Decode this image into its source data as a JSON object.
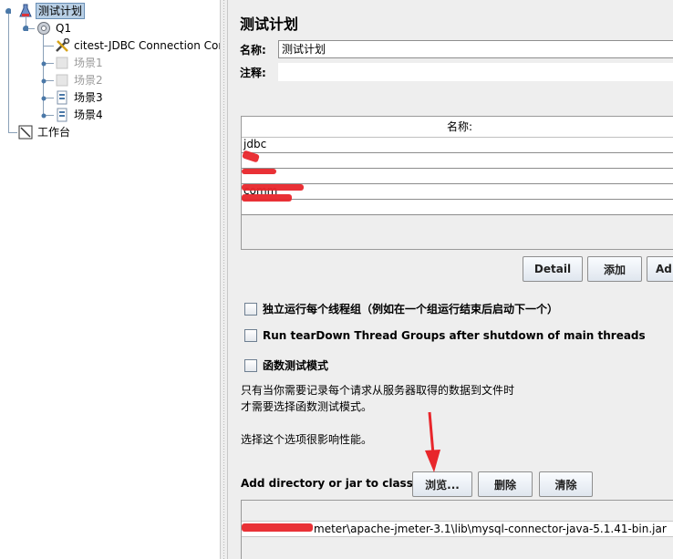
{
  "tree": {
    "root_label": "测试计划",
    "thread_group_label": "Q1",
    "jdbc_config_label": "citest-JDBC Connection Con",
    "scenes": [
      {
        "label": "场景1",
        "disabled": true
      },
      {
        "label": "场景2",
        "disabled": true
      },
      {
        "label": "场景3",
        "disabled": false
      },
      {
        "label": "场景4",
        "disabled": false
      }
    ],
    "workbench_label": "工作台"
  },
  "panel": {
    "title": "测试计划",
    "name_label": "名称:",
    "name_value": "测试计划",
    "comment_label": "注释:",
    "comment_value": "",
    "variables_header": "名称:",
    "variables": [
      "jdbc",
      "",
      "",
      "comm",
      ""
    ],
    "buttons": {
      "detail": "Detail",
      "add": "添加",
      "add_clipboard": "Ad"
    },
    "options": {
      "run_independent": "独立运行每个线程组（例如在一个组运行结束后启动下一个）",
      "teardown": "Run tearDown Thread Groups after shutdown of main threads",
      "functional_mode": "函数测试模式"
    },
    "note_line1": "只有当你需要记录每个请求从服务器取得的数据到文件时",
    "note_line2": "才需要选择函数测试模式。",
    "note_line3": "选择这个选项很影响性能。",
    "classpath": {
      "label": "Add directory or jar to classpath",
      "browse": "浏览...",
      "delete": "删除",
      "clear": "清除",
      "entry": "meter\\apache-jmeter-3.1\\lib\\mysql-connector-java-5.1.41-bin.jar"
    }
  },
  "colors": {
    "annotation_red": "#e8262b",
    "selection": "#b8cfe5"
  }
}
